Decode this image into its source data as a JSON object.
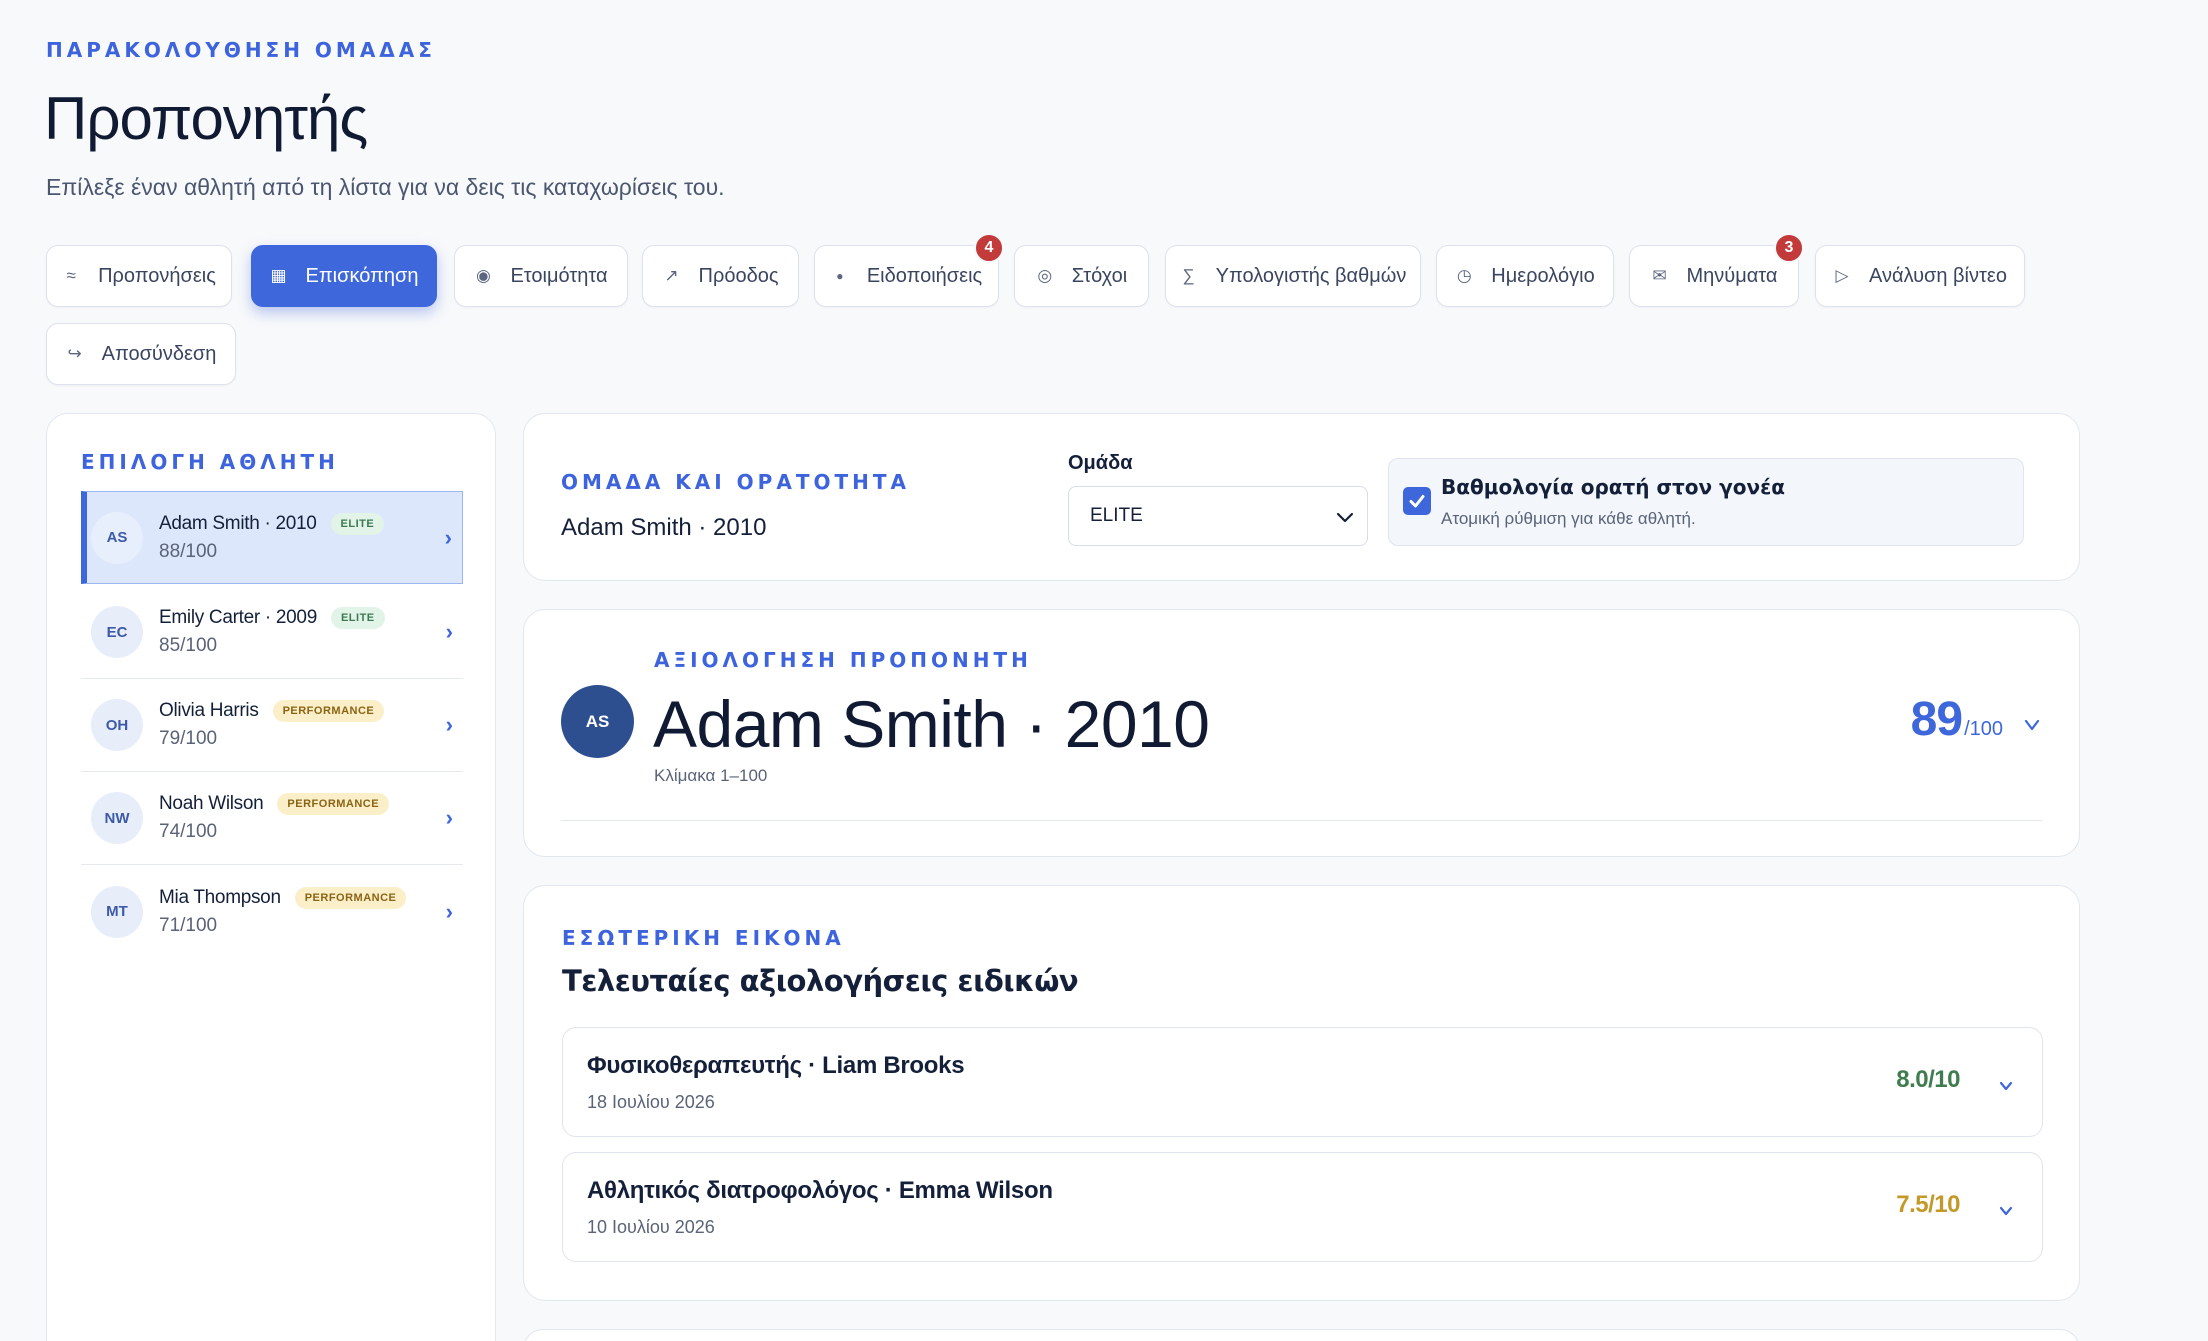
{
  "header": {
    "eyebrow": "ΠΑΡΑΚΟΛΟΥΘΗΣΗ ΟΜΑΔΑΣ",
    "title": "Προπονητής",
    "subtitle": "Επίλεξε έναν αθλητή από τη λίστα για να δεις τις καταχωρίσεις του."
  },
  "nav": {
    "items": [
      {
        "label": "Προπονήσεις",
        "icon": "≈"
      },
      {
        "label": "Επισκόπηση",
        "icon": "▦"
      },
      {
        "label": "Ετοιμότητα",
        "icon": "◉"
      },
      {
        "label": "Πρόοδος",
        "icon": "↗"
      },
      {
        "label": "Ειδοποιήσεις",
        "icon": "●",
        "badge": "4"
      },
      {
        "label": "Στόχοι",
        "icon": "◎"
      },
      {
        "label": "Υπολογιστής βαθμών",
        "icon": "∑"
      },
      {
        "label": "Ημερολόγιο",
        "icon": "◷"
      },
      {
        "label": "Μηνύματα",
        "icon": "✉",
        "badge": "3"
      },
      {
        "label": "Ανάλυση βίντεο",
        "icon": "▷"
      },
      {
        "label": "Αποσύνδεση",
        "icon": "↪"
      }
    ],
    "active_index": 1
  },
  "sidebar": {
    "title": "ΕΠΙΛΟΓΗ ΑΘΛΗΤΗ",
    "athletes": [
      {
        "initials": "AS",
        "name": "Adam Smith · 2010",
        "score": "88/100",
        "tag": "ELITE"
      },
      {
        "initials": "EC",
        "name": "Emily Carter · 2009",
        "score": "85/100",
        "tag": "ELITE"
      },
      {
        "initials": "OH",
        "name": "Olivia Harris",
        "score": "79/100",
        "tag": "PERFORMANCE"
      },
      {
        "initials": "NW",
        "name": "Noah Wilson",
        "score": "74/100",
        "tag": "PERFORMANCE"
      },
      {
        "initials": "MT",
        "name": "Mia Thompson",
        "score": "71/100",
        "tag": "PERFORMANCE"
      }
    ],
    "selected_index": 0
  },
  "team": {
    "eyebrow": "ΟΜΑΔΑ ΚΑΙ ΟΡΑΤΟΤΗΤΑ",
    "athlete": "Adam Smith · 2010",
    "label": "Ομάδα",
    "selected": "ELITE",
    "visibility_title": "Βαθμολογία ορατή στον γονέα",
    "visibility_sub": "Ατομική ρύθμιση για κάθε αθλητή.",
    "visibility_checked": true
  },
  "evaluation": {
    "eyebrow": "ΑΞΙΟΛΟΓΗΣΗ ΠΡΟΠΟΝΗΤΗ",
    "initials": "AS",
    "name": "Adam Smith · 2010",
    "scale": "Κλίμακα 1–100",
    "score": "89",
    "score_max": "/100"
  },
  "experts": {
    "eyebrow": "ΕΣΩΤΕΡΙΚΗ ΕΙΚΟΝΑ",
    "title": "Τελευταίες αξιολογήσεις ειδικών",
    "reviews": [
      {
        "title": "Φυσικοθεραπευτής · Liam Brooks",
        "date": "18 Ιουλίου 2026",
        "score": "8.0/10",
        "color": "#3f7d4f"
      },
      {
        "title": "Αθλητικός διατροφολόγος · Emma Wilson",
        "date": "10 Ιουλίου 2026",
        "score": "7.5/10",
        "color": "#c39a2a"
      }
    ]
  },
  "colors": {
    "accent": "#3e67dc",
    "badge": "#c23a3a"
  }
}
